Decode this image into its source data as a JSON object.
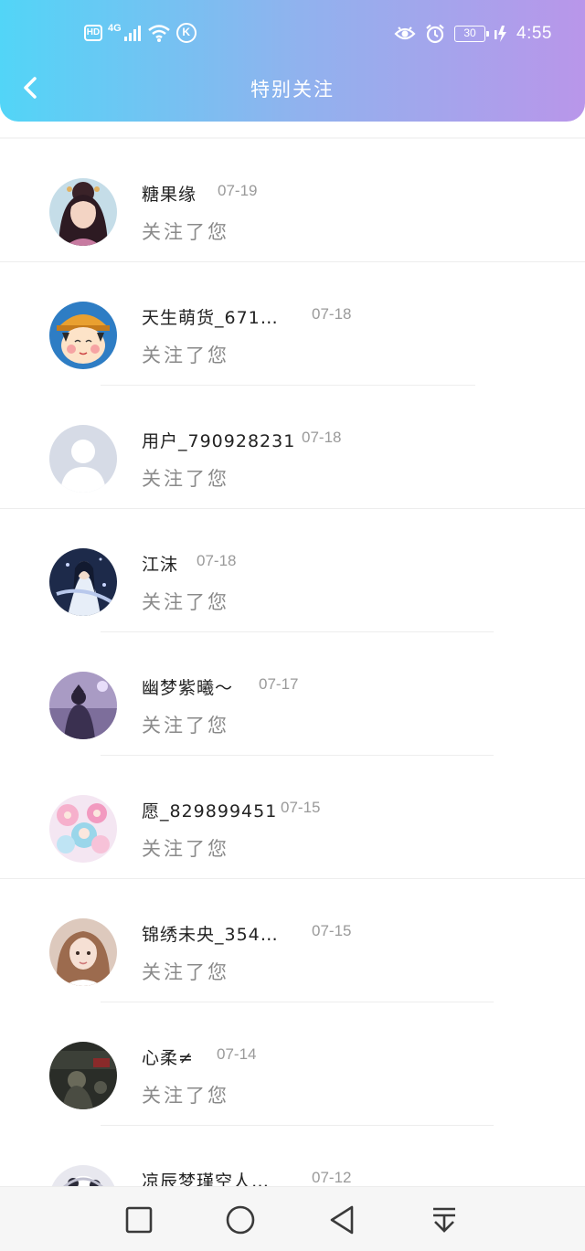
{
  "status_bar": {
    "hd": "HD",
    "network": "4G",
    "k_icon": "K",
    "battery": "30",
    "time": "4:55"
  },
  "header": {
    "title": "特别关注"
  },
  "list": [
    {
      "name": "糖果缘",
      "date": "07-19",
      "action": "关注了您"
    },
    {
      "name": "天生萌货_671…",
      "date": "07-18",
      "action": "关注了您"
    },
    {
      "name": "用户_790928231",
      "date": "07-18",
      "action": "关注了您"
    },
    {
      "name": "江沫",
      "date": "07-18",
      "action": "关注了您"
    },
    {
      "name": "幽梦紫曦～",
      "date": "07-17",
      "action": "关注了您"
    },
    {
      "name": "愿_829899451",
      "date": "07-15",
      "action": "关注了您"
    },
    {
      "name": "锦绣未央_354…",
      "date": "07-15",
      "action": "关注了您"
    },
    {
      "name": "心柔≠",
      "date": "07-14",
      "action": "关注了您"
    },
    {
      "name": "凉辰梦瑾空人…",
      "date": "07-12",
      "action": ""
    }
  ],
  "nav_bar": {
    "icons": [
      "recent-apps-icon",
      "home-icon",
      "back-icon",
      "notification-pulldown-icon"
    ]
  }
}
